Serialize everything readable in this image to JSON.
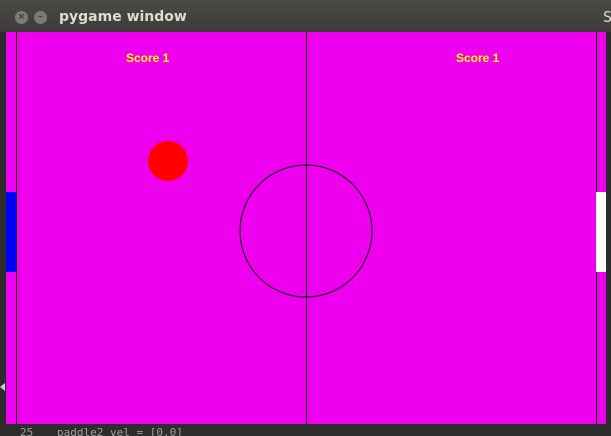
{
  "window": {
    "title": "pygame window",
    "close_glyph": "×",
    "minimize_glyph": "–",
    "edge_glyph": "S"
  },
  "game": {
    "left_score": "Score 1",
    "right_score": "Score 1",
    "ball_color": "#ff0000",
    "field_color": "#ee00ee",
    "left_paddle_color": "#0000ff",
    "right_paddle_color": "#ffffff",
    "line_color": "#000000",
    "score_color": "#ffff00"
  },
  "editor_peek": {
    "line_number": "25",
    "code_text": "paddle2_vel = [0,0]"
  }
}
